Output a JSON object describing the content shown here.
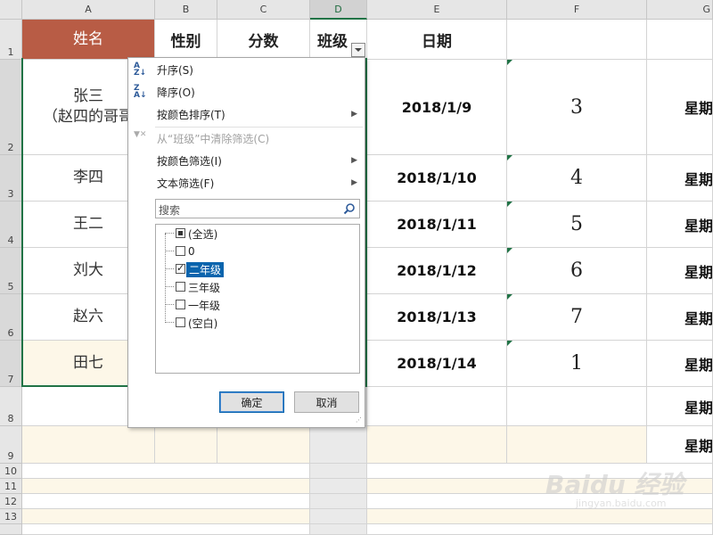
{
  "sheet": {
    "columns": [
      "A",
      "B",
      "C",
      "D",
      "E",
      "F",
      "G"
    ],
    "rows": [
      "1",
      "2",
      "3",
      "4",
      "5",
      "6",
      "7",
      "8",
      "9",
      "10",
      "11",
      "12",
      "13"
    ],
    "header_row": {
      "name": "姓名",
      "gender": "性别",
      "score": "分数",
      "class": "班级",
      "date": "日期"
    },
    "records": [
      {
        "name_line1": "张三",
        "name_line2": "（赵四的哥哥",
        "date": "2018/1/9",
        "num": "3",
        "week": "星期"
      },
      {
        "name": "李四",
        "date": "2018/1/10",
        "num": "4",
        "week": "星期"
      },
      {
        "name": "王二",
        "date": "2018/1/11",
        "num": "5",
        "week": "星期"
      },
      {
        "name": "刘大",
        "date": "2018/1/12",
        "num": "6",
        "week": "星期"
      },
      {
        "name": "赵六",
        "date": "2018/1/13",
        "num": "7",
        "week": "星期"
      },
      {
        "name": "田七",
        "date": "2018/1/14",
        "num": "1",
        "week": "星期"
      }
    ],
    "row8_week": "星期",
    "row9_week": "星期",
    "colors": {
      "header_fill": "#b85c45",
      "cream": "#fdf7e8",
      "selection": "#217346"
    }
  },
  "filter_menu": {
    "sort_asc": "升序(S)",
    "sort_desc": "降序(O)",
    "sort_by_color": "按颜色排序(T)",
    "clear_filter": "从“班级”中清除筛选(C)",
    "filter_by_color": "按颜色筛选(I)",
    "text_filter": "文本筛选(F)",
    "search_placeholder": "搜索",
    "items": [
      {
        "label": "(全选)",
        "state": "partial"
      },
      {
        "label": "0",
        "state": "unchecked"
      },
      {
        "label": "二年级",
        "state": "checked"
      },
      {
        "label": "三年级",
        "state": "unchecked"
      },
      {
        "label": "一年级",
        "state": "unchecked"
      },
      {
        "label": "(空白)",
        "state": "unchecked"
      }
    ],
    "ok": "确定",
    "cancel": "取消",
    "icons": {
      "sort_asc": "sort-ascending-icon",
      "sort_desc": "sort-descending-icon",
      "clear": "clear-filter-icon",
      "search": "search-icon"
    }
  },
  "watermark": {
    "brand": "Baidu 经验",
    "url": "jingyan.baidu.com"
  }
}
